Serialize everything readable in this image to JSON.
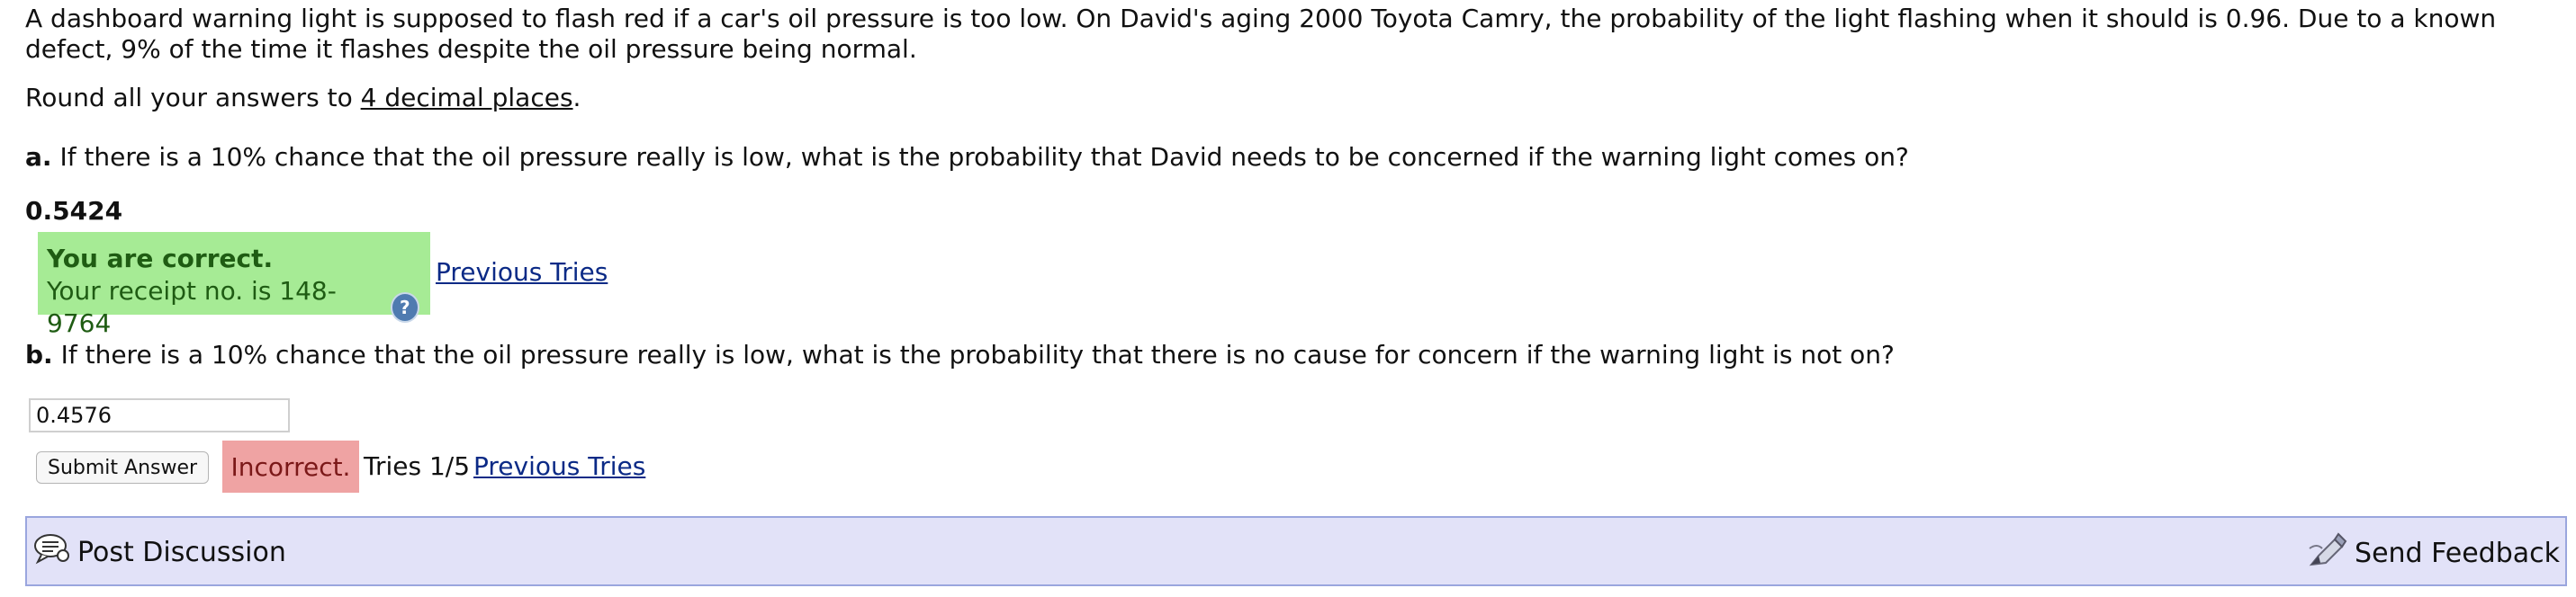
{
  "problem": {
    "intro": "A dashboard warning light is supposed to flash red if a car's oil pressure is too low. On David's aging 2000 Toyota Camry, the probability of the light flashing when it should is 0.96. Due to a known defect, 9% of the time it flashes despite the oil pressure being normal.",
    "round_prefix": "Round all your answers to ",
    "round_emphasis": "4 decimal places",
    "round_suffix": "."
  },
  "part_a": {
    "label": "a.",
    "question": "If there is a 10% chance that the oil pressure really is low, what is the probability that David needs to be concerned if the warning light comes on?",
    "answer": "0.5424",
    "status_title": "You are correct.",
    "receipt_text": "Your receipt no. is 148-9764",
    "help_glyph": "?",
    "previous_tries_label": "Previous Tries"
  },
  "part_b": {
    "label": "b.",
    "question": "If there is a 10% chance that the oil pressure really is low, what is the probability that there is no cause for concern if the warning light is not on?",
    "input_value": "0.4576",
    "submit_label": "Submit Answer",
    "status": "Incorrect.",
    "tries_text": "Tries 1/5",
    "previous_tries_label": "Previous Tries"
  },
  "footer": {
    "post_discussion": "Post Discussion",
    "send_feedback": "Send Feedback",
    "post_icon": "discussion-bubble-icon",
    "feedback_icon": "feedback-pencil-icon"
  },
  "colors": {
    "correct_bg": "#a6eb95",
    "incorrect_bg": "#efa3a3",
    "footer_bg": "#e2e2f8",
    "link": "#0b2a86"
  }
}
